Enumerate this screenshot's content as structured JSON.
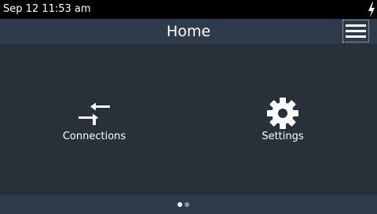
{
  "status_bar": {
    "datetime": "Sep 12 11:53 am",
    "charging_icon": "lightning-bolt"
  },
  "header": {
    "title": "Home",
    "menu_icon": "hamburger-menu"
  },
  "main": {
    "tiles": [
      {
        "label": "Connections",
        "icon": "connections-arrows"
      },
      {
        "label": "Settings",
        "icon": "gear"
      }
    ]
  },
  "footer": {
    "page_count": 2,
    "current_page": 1
  },
  "colors": {
    "status_bar": "#000000",
    "header": "#2e3b4a",
    "background": "#263238",
    "text": "#ffffff",
    "dot_active": "#ffffff",
    "dot_inactive": "#8a96a3"
  }
}
